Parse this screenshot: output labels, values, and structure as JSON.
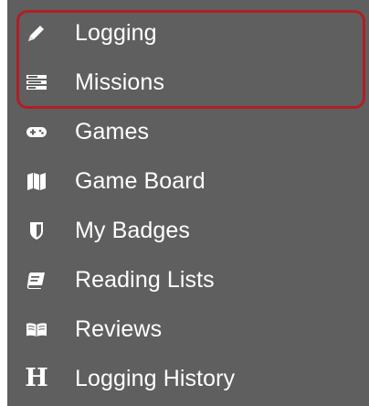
{
  "menu": {
    "items": [
      {
        "label": "Logging",
        "icon": "pencil-icon"
      },
      {
        "label": "Missions",
        "icon": "list-icon"
      },
      {
        "label": "Games",
        "icon": "gamepad-icon"
      },
      {
        "label": "Game Board",
        "icon": "map-icon"
      },
      {
        "label": "My Badges",
        "icon": "shield-icon"
      },
      {
        "label": "Reading Lists",
        "icon": "book-icon"
      },
      {
        "label": "Reviews",
        "icon": "open-book-icon"
      },
      {
        "label": "Logging History",
        "icon": "h-letter-icon",
        "icon_text": "H"
      }
    ],
    "highlight_color": "#b01f24",
    "background_color": "#5f5f5f"
  }
}
